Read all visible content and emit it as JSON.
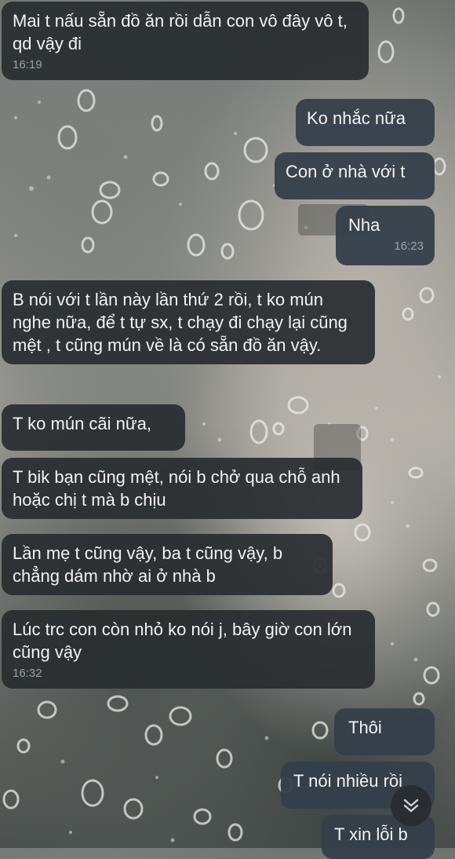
{
  "messages": [
    {
      "dir": "in",
      "text": "Mai t nấu sẵn đồ ăn rồi dẫn con vô đây vô t, qd vậy đi",
      "time": "16:19"
    },
    {
      "dir": "out",
      "text": "Ko nhắc nữa"
    },
    {
      "dir": "out",
      "text": "Con ở nhà với t"
    },
    {
      "dir": "out",
      "text": "Nha",
      "time": "16:23"
    },
    {
      "dir": "in",
      "text": "B nói với t lần này lần thứ 2 rồi, t ko mún nghe nữa, để t tự sx, t chạy đi chạy lại cũng mệt , t cũng mún về là có sẵn đồ ăn vậy."
    },
    {
      "dir": "in",
      "text": "T ko mún cãi nữa,"
    },
    {
      "dir": "in",
      "text": "T bik bạn cũng mệt, nói b chở qua chỗ anh  hoặc chị t mà b chịu"
    },
    {
      "dir": "in",
      "text": "Lần mẹ t cũng vậy, ba t cũng vậy, b chẳng dám nhờ ai ở nhà b"
    },
    {
      "dir": "in",
      "text": "Lúc trc con còn nhỏ ko nói j, bây giờ con lớn cũng vậy",
      "time": "16:32"
    },
    {
      "dir": "out",
      "text": "Thôi"
    },
    {
      "dir": "out",
      "text": "T nói nhiều rồi"
    },
    {
      "dir": "out",
      "text": "T xin lỗi b"
    }
  ],
  "scroll_button": {
    "icon": "double-chevron-down-icon"
  }
}
